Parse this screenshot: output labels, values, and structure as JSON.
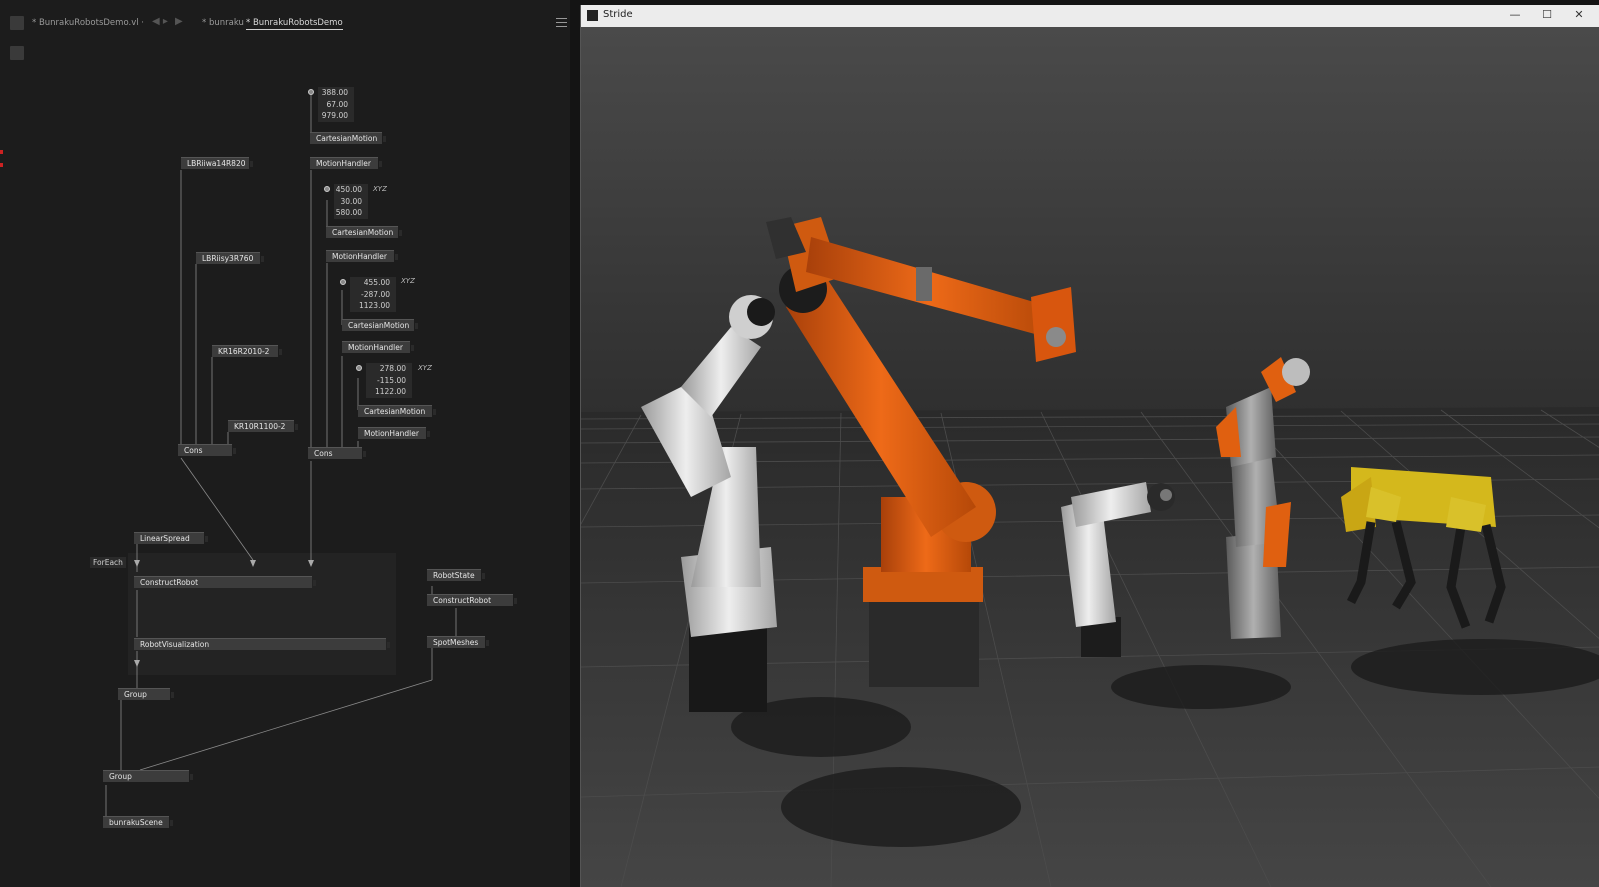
{
  "editor": {
    "tabs": [
      {
        "label": "* BunrakuRobotsDemo.vl ·"
      },
      {
        "label": "* bunraku"
      },
      {
        "label": "* BunrakuRobotsDemo"
      }
    ],
    "nodes": {
      "cartesian1": "CartesianMotion",
      "motion1": "MotionHandler",
      "lbr14": "LBRiiwa14R820",
      "cartesian2": "CartesianMotion",
      "motion2": "MotionHandler",
      "lbr3": "LBRiisy3R760",
      "cartesian3": "CartesianMotion",
      "motion3": "MotionHandler",
      "kr16": "KR16R2010-2",
      "cartesian4": "CartesianMotion",
      "motion4": "MotionHandler",
      "kr10": "KR10R1100-2",
      "cons1": "Cons",
      "cons2": "Cons",
      "linearspread": "LinearSpread",
      "foreach": "ForEach",
      "constructrobot1": "ConstructRobot",
      "robotviz": "RobotVisualization",
      "robotstate": "RobotState",
      "constructrobot2": "ConstructRobot",
      "spotmeshes": "SpotMeshes",
      "group1": "Group",
      "group2": "Group",
      "scene": "bunrakuScene"
    },
    "vectors": {
      "v1": [
        "388.00",
        "67.00",
        "979.00"
      ],
      "v2": [
        "450.00",
        "30.00",
        "580.00"
      ],
      "v3": [
        "455.00",
        "-287.00",
        "1123.00"
      ],
      "v4": [
        "278.00",
        "-115.00",
        "1122.00"
      ]
    },
    "xyz_label": "XYZ"
  },
  "stride": {
    "title": "Stride",
    "buttons": {
      "minimize": "—",
      "maximize": "☐",
      "close": "✕"
    },
    "colors": {
      "orange": "#d9570f",
      "white_robot": "#d8d8d8",
      "spot_yellow": "#d4b81c",
      "floor": "#303030"
    }
  }
}
